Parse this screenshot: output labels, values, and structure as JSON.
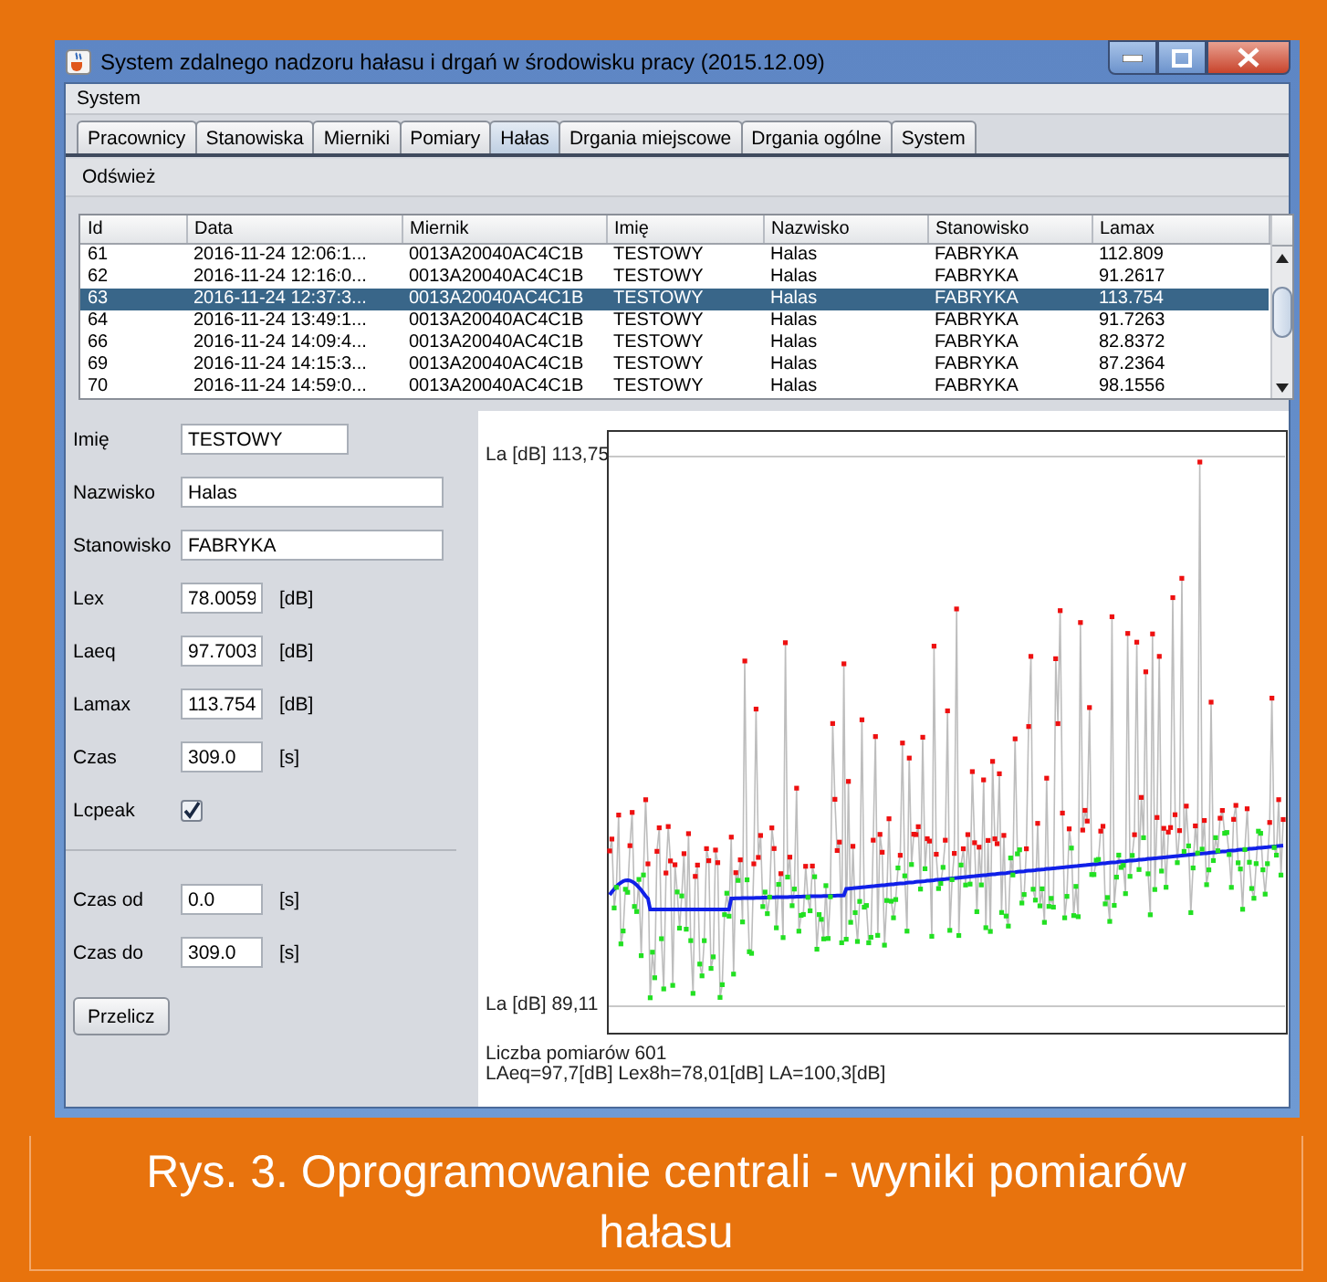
{
  "window": {
    "title": "System zdalnego nadzoru hałasu i drgań w środowisku pracy (2015.12.09)"
  },
  "menu": [
    "System"
  ],
  "tabs": [
    {
      "label": "Pracownicy",
      "selected": false
    },
    {
      "label": "Stanowiska",
      "selected": false
    },
    {
      "label": "Mierniki",
      "selected": false
    },
    {
      "label": "Pomiary",
      "selected": false
    },
    {
      "label": "Hałas",
      "selected": true
    },
    {
      "label": "Drgania miejscowe",
      "selected": false
    },
    {
      "label": "Drgania ogólne",
      "selected": false
    },
    {
      "label": "System",
      "selected": false
    }
  ],
  "toolbar": [
    "Odśwież"
  ],
  "table": {
    "columns": [
      "Id",
      "Data",
      "Miernik",
      "Imię",
      "Nazwisko",
      "Stanowisko",
      "Lamax"
    ],
    "rows": [
      {
        "cells": [
          "61",
          "2016-11-24 12:06:1...",
          "0013A20040AC4C1B",
          "TESTOWY",
          "Halas",
          "FABRYKA",
          "112.809"
        ],
        "selected": false
      },
      {
        "cells": [
          "62",
          "2016-11-24 12:16:0...",
          "0013A20040AC4C1B",
          "TESTOWY",
          "Halas",
          "FABRYKA",
          "91.2617"
        ],
        "selected": false
      },
      {
        "cells": [
          "63",
          "2016-11-24 12:37:3...",
          "0013A20040AC4C1B",
          "TESTOWY",
          "Halas",
          "FABRYKA",
          "113.754"
        ],
        "selected": true
      },
      {
        "cells": [
          "64",
          "2016-11-24 13:49:1...",
          "0013A20040AC4C1B",
          "TESTOWY",
          "Halas",
          "FABRYKA",
          "91.7263"
        ],
        "selected": false
      },
      {
        "cells": [
          "66",
          "2016-11-24 14:09:4...",
          "0013A20040AC4C1B",
          "TESTOWY",
          "Halas",
          "FABRYKA",
          "82.8372"
        ],
        "selected": false
      },
      {
        "cells": [
          "69",
          "2016-11-24 14:15:3...",
          "0013A20040AC4C1B",
          "TESTOWY",
          "Halas",
          "FABRYKA",
          "87.2364"
        ],
        "selected": false
      },
      {
        "cells": [
          "70",
          "2016-11-24 14:59:0...",
          "0013A20040AC4C1B",
          "TESTOWY",
          "Halas",
          "FABRYKA",
          "98.1556"
        ],
        "selected": false
      }
    ]
  },
  "form": {
    "fields": [
      {
        "kind": "short",
        "label": "Imię",
        "value": "TESTOWY"
      },
      {
        "kind": "long",
        "label": "Nazwisko",
        "value": "Halas"
      },
      {
        "kind": "long",
        "label": "Stanowisko",
        "value": "FABRYKA"
      },
      {
        "kind": "number",
        "label": "Lex",
        "value": "78.0059",
        "unit": "[dB]"
      },
      {
        "kind": "number",
        "label": "Laeq",
        "value": "97.7003",
        "unit": "[dB]"
      },
      {
        "kind": "number",
        "label": "Lamax",
        "value": "113.754",
        "unit": "[dB]"
      },
      {
        "kind": "number",
        "label": "Czas",
        "value": "309.0",
        "unit": "[s]"
      },
      {
        "kind": "checkbox",
        "label": "Lcpeak",
        "checked": true
      }
    ],
    "range": [
      {
        "kind": "number",
        "label": "Czas od",
        "value": "0.0",
        "unit": "[s]"
      },
      {
        "kind": "number",
        "label": "Czas do",
        "value": "309.0",
        "unit": "[s]"
      }
    ],
    "button": "Przelicz"
  },
  "chart": {
    "max_label": "La [dB] 113,75",
    "min_label": "La [dB] 89,11",
    "summary": [
      "Liczba pomiarów 601",
      "LAeq=97,7[dB] Lex8h=78,01[dB] LA=100,3[dB]"
    ]
  },
  "caption": "Rys. 3. Oprogramowanie centrali - wyniki pomiarów hałasu"
}
